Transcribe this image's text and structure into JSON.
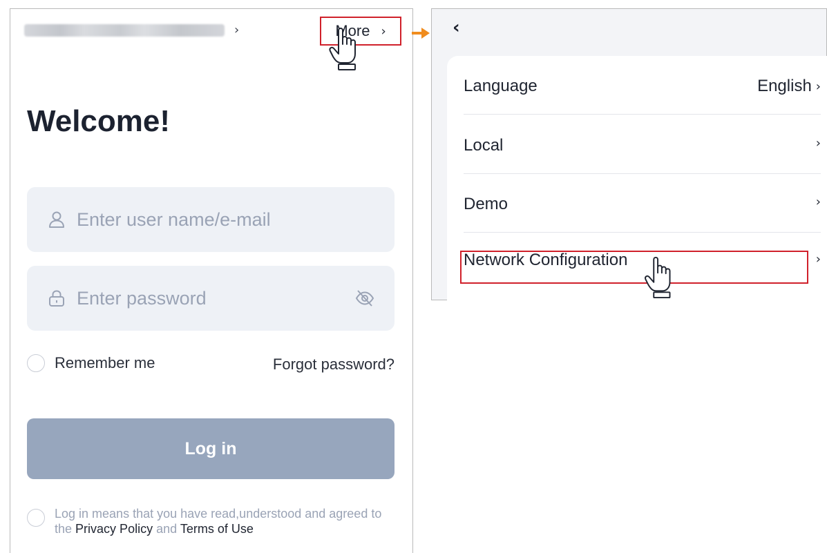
{
  "login": {
    "more_label": "More",
    "welcome": "Welcome!",
    "username_placeholder": "Enter user name/e-mail",
    "password_placeholder": "Enter password",
    "remember_label": "Remember me",
    "forgot_label": "Forgot password?",
    "login_label": "Log in",
    "agree_prefix": "Log in means that you have read,understood and agreed to the",
    "privacy_link": "Privacy Policy",
    "agree_and": "and",
    "terms_link": "Terms of Use"
  },
  "settings_menu": {
    "items": [
      {
        "label": "Language",
        "value": "English"
      },
      {
        "label": "Local",
        "value": ""
      },
      {
        "label": "Demo",
        "value": ""
      },
      {
        "label": "Network Configuration",
        "value": ""
      }
    ]
  },
  "colors": {
    "highlight": "#d0202a",
    "arrow": "#f08c1e",
    "login_button": "#97a6bd",
    "field_bg": "#eef1f6"
  },
  "icons": [
    "chevron-right-icon",
    "pointing-hand-icon",
    "user-icon",
    "lock-icon",
    "eye-off-icon",
    "back-icon",
    "arrow-right-icon"
  ]
}
